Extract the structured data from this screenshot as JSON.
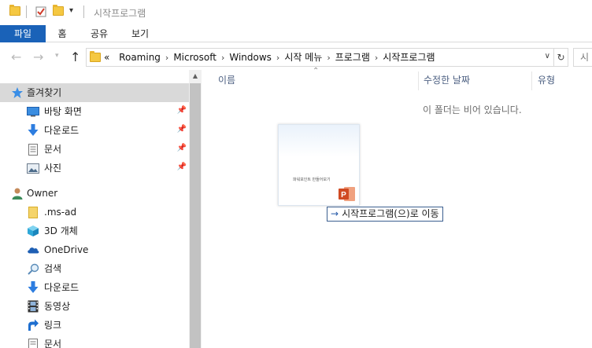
{
  "window": {
    "title": "시작프로그램"
  },
  "ribbon": {
    "tabs": [
      "파일",
      "홈",
      "공유",
      "보기"
    ]
  },
  "address": {
    "overflow": "«",
    "crumbs": [
      "Roaming",
      "Microsoft",
      "Windows",
      "시작 메뉴",
      "프로그램",
      "시작프로그램"
    ],
    "search_placeholder": "시"
  },
  "nav": {
    "quick_access": "즐겨찾기",
    "pinned": [
      "바탕 화면",
      "다운로드",
      "문서",
      "사진"
    ],
    "user": "Owner",
    "user_items": [
      ".ms-ad",
      "3D 개체",
      "OneDrive",
      "검색",
      "다운로드",
      "동영상",
      "링크",
      "문서"
    ]
  },
  "columns": {
    "name": "이름",
    "modified": "수정한 날짜",
    "type": "유형"
  },
  "content": {
    "empty_message": "이 폴더는 비어 있습니다."
  },
  "drag": {
    "file_label": "파워포인트 만들어보기",
    "tooltip": "시작프로그램(으)로 이동"
  },
  "colors": {
    "file_tab": "#1a62b8",
    "selected_nav": "#d9d9d9",
    "column_header": "#4d6082"
  }
}
